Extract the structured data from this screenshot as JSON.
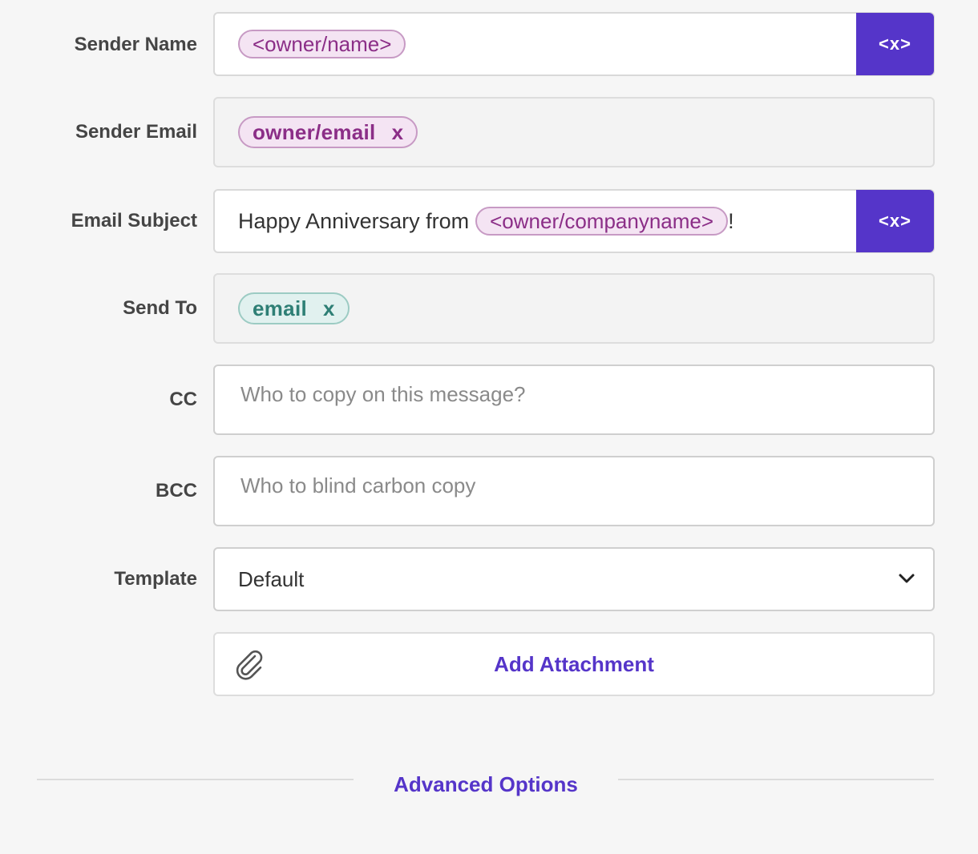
{
  "form": {
    "sender_name": {
      "label": "Sender Name",
      "token": "<owner/name>",
      "var_button": "<x>"
    },
    "sender_email": {
      "label": "Sender Email",
      "token": "owner/email",
      "remove": "x"
    },
    "email_subject": {
      "label": "Email Subject",
      "prefix": "Happy Anniversary from",
      "token": "<owner/companyname>",
      "suffix": "!",
      "var_button": "<x>"
    },
    "send_to": {
      "label": "Send To",
      "token": "email",
      "remove": "x"
    },
    "cc": {
      "label": "CC",
      "placeholder": "Who to copy on this message?"
    },
    "bcc": {
      "label": "BCC",
      "placeholder": "Who to blind carbon copy"
    },
    "template": {
      "label": "Template",
      "selected": "Default"
    },
    "attachment": {
      "label": "Add Attachment",
      "icon": "paperclip-icon"
    },
    "advanced_options": "Advanced Options"
  },
  "colors": {
    "accent": "#5535c9",
    "token_purple_bg": "#f4e4f3",
    "token_purple_text": "#8b2e87",
    "token_teal_bg": "#e1f1ef",
    "token_teal_text": "#2e7f75",
    "background": "#f6f6f6"
  }
}
